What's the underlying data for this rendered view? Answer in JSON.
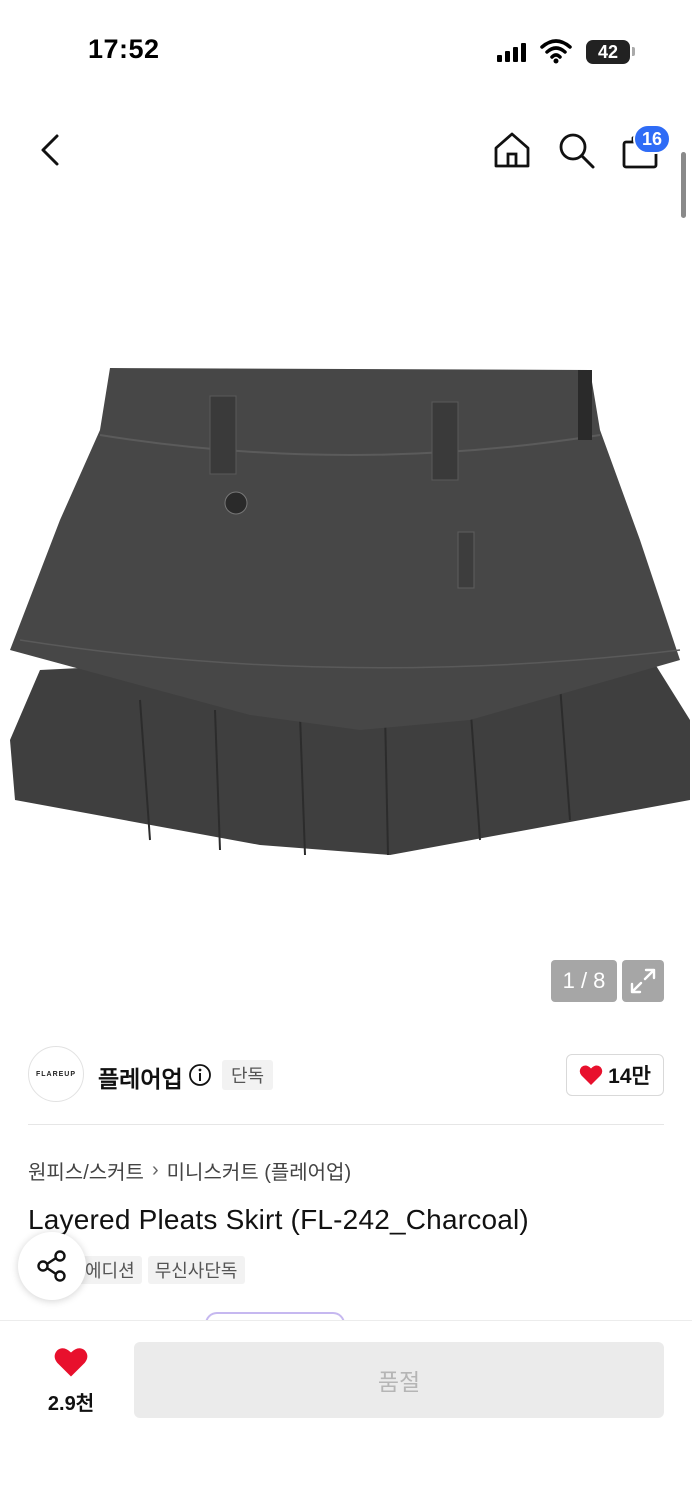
{
  "status_bar": {
    "time": "17:52",
    "battery": "42"
  },
  "header": {
    "cart_count": "16",
    "icons": [
      "back-icon",
      "home-icon",
      "search-icon",
      "bag-icon"
    ]
  },
  "gallery": {
    "pager": "1 / 8"
  },
  "brand": {
    "logo_text": "FLAREUP",
    "name": "플레어업",
    "tag": "단독",
    "likes": "14만"
  },
  "product": {
    "breadcrumb": [
      "원피스/스커트",
      "미니스커트 (플레어업)"
    ],
    "title": "Layered Pleats Skirt (FL-242_Charcoal)",
    "tags": [
      "에디션",
      "무신사단독"
    ]
  },
  "bottom_bar": {
    "wish_count": "2.9천",
    "action_label": "품절"
  },
  "colors": {
    "accent_badge": "#2f6cf6",
    "heart": "#e8102d",
    "disabled_bg": "#ebebeb"
  }
}
